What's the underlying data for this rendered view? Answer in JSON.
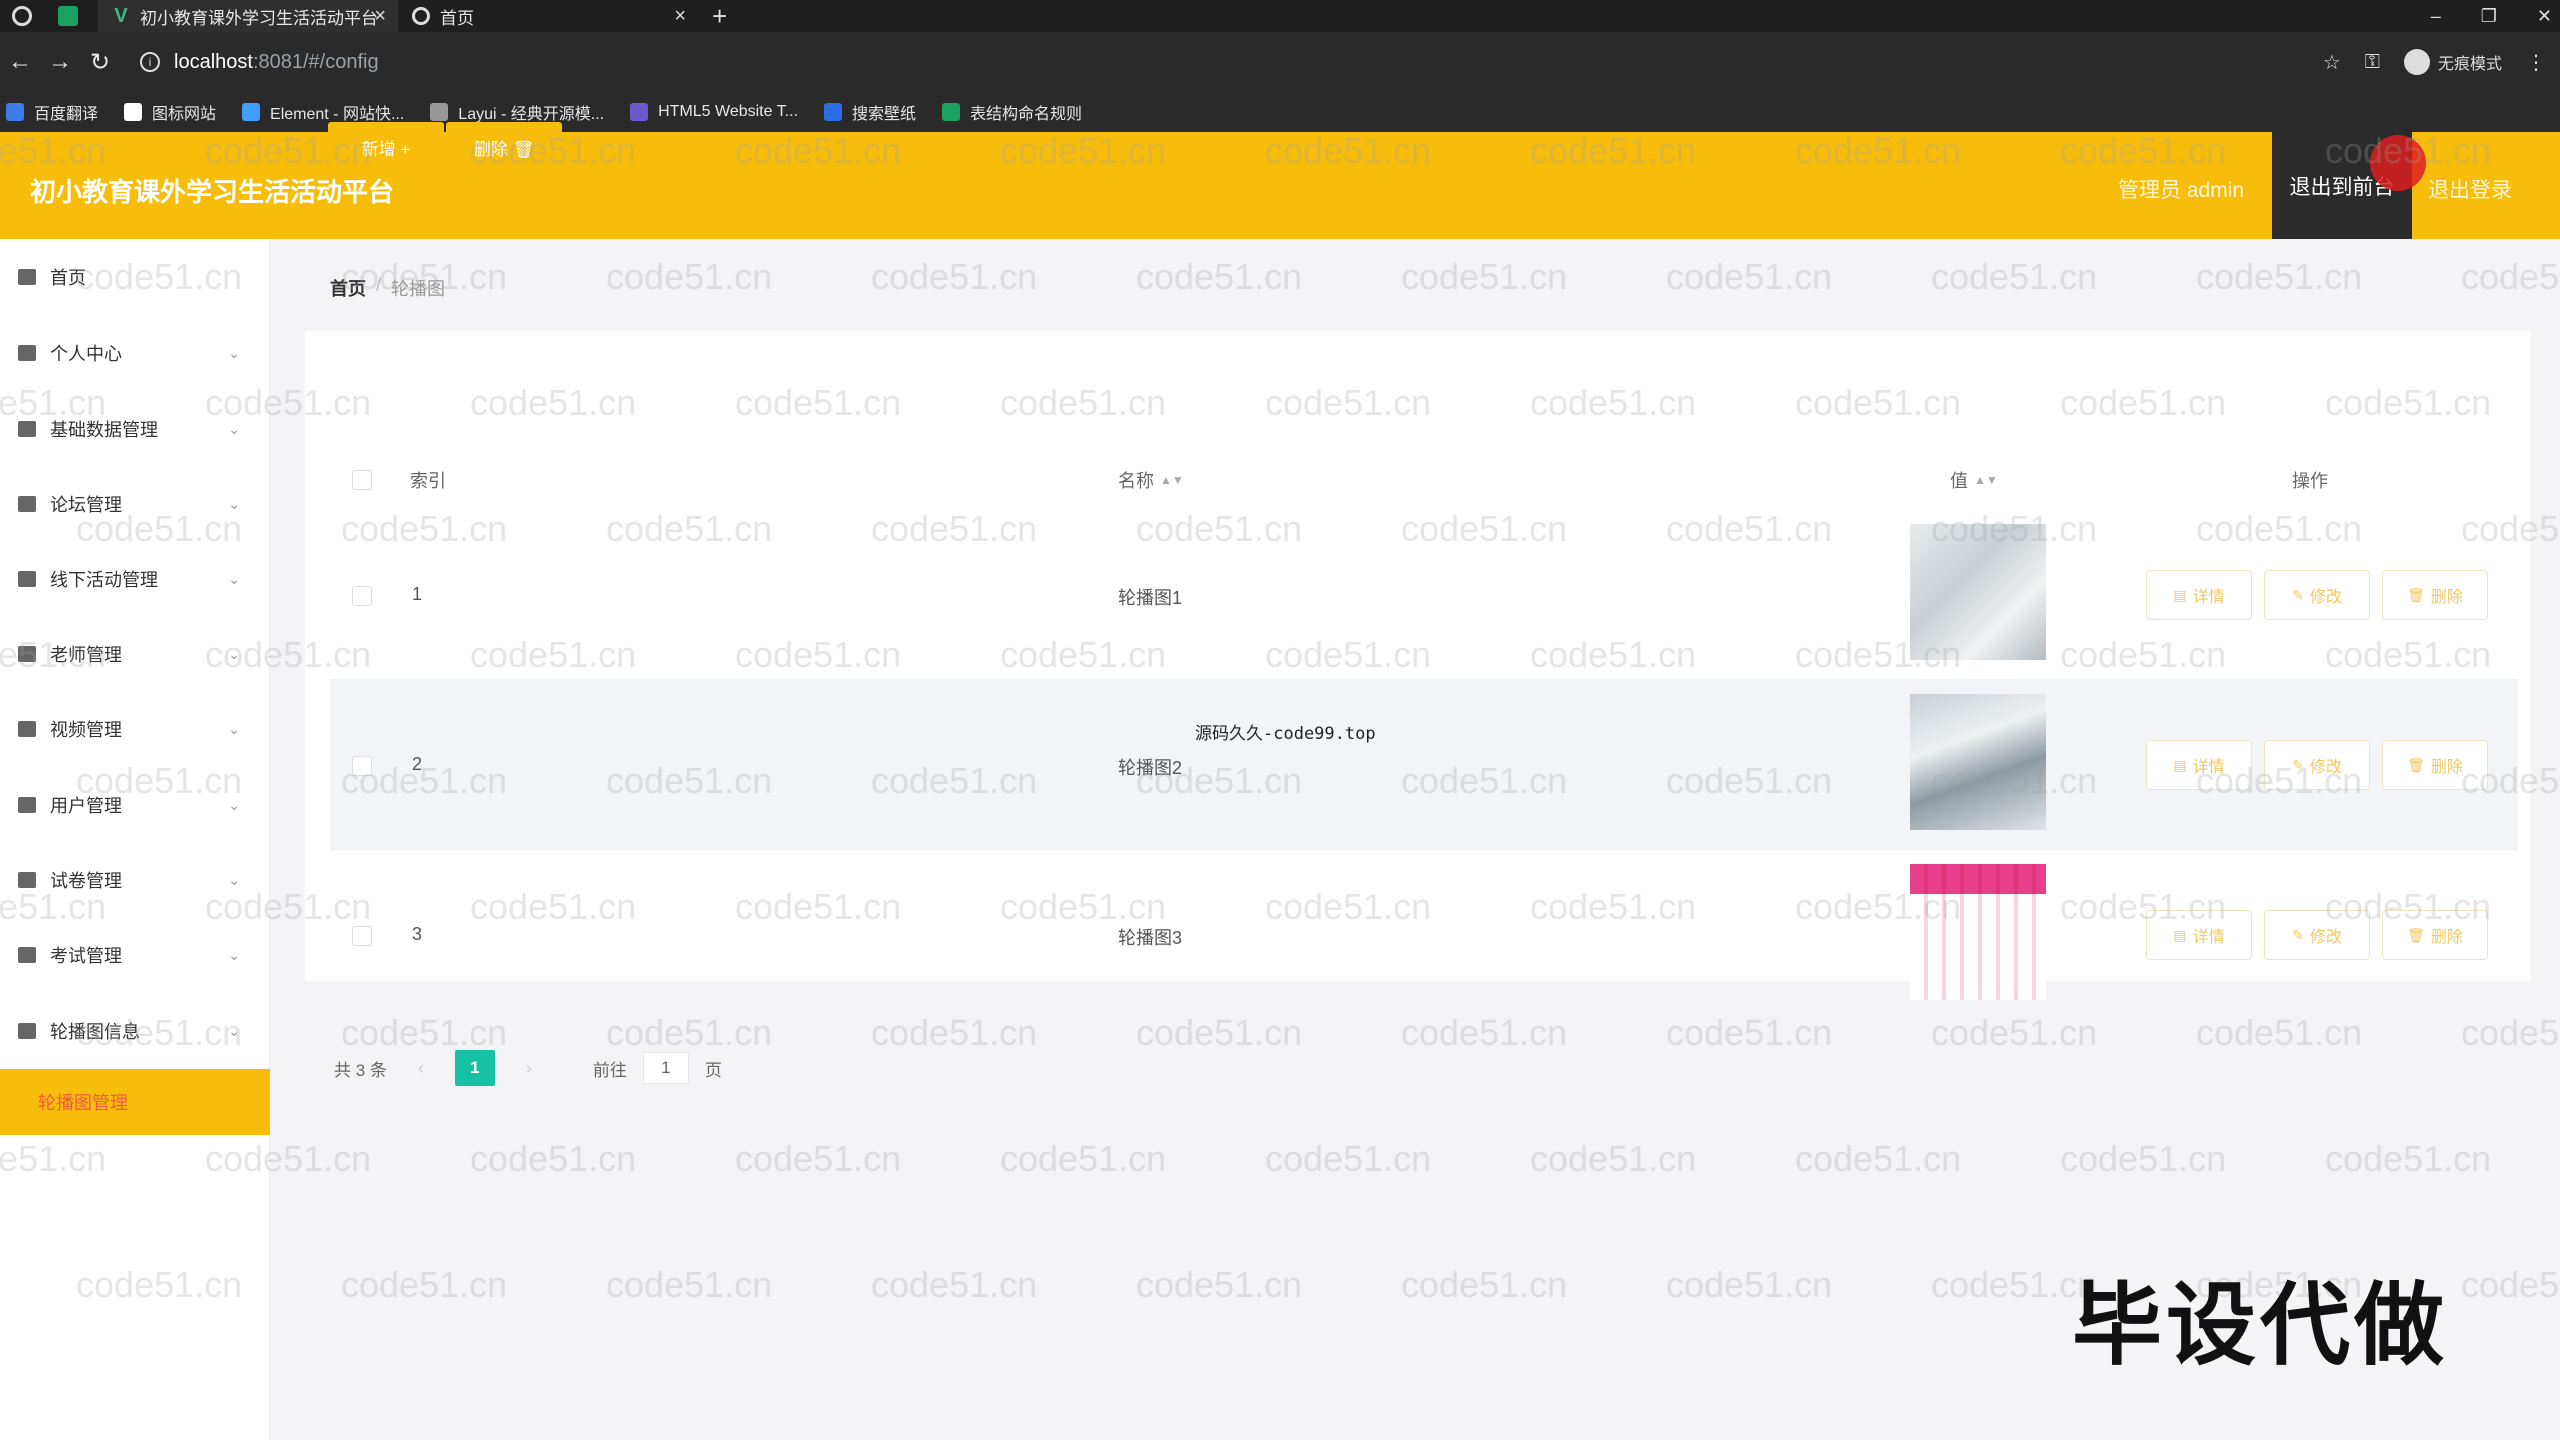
{
  "browser": {
    "tabs": [
      {
        "title": "初小教育课外学习生活活动平台",
        "close": "×"
      },
      {
        "title": "首页",
        "close": "×"
      }
    ],
    "new_tab": "+",
    "url_host": "localhost",
    "url_path": ":8081/#/config",
    "incognito_label": "无痕模式",
    "bookmarks": [
      {
        "label": "百度翻译",
        "color": "#3b7ce8"
      },
      {
        "label": "图标网站",
        "color": "#ffffff"
      },
      {
        "label": "Element - 网站快...",
        "color": "#409eff"
      },
      {
        "label": "Layui - 经典开源模...",
        "color": "#999999"
      },
      {
        "label": "HTML5 Website T...",
        "color": "#6a5acd"
      },
      {
        "label": "搜索壁纸",
        "color": "#2b6de0"
      },
      {
        "label": "表结构命名规则",
        "color": "#1aa260"
      }
    ]
  },
  "header": {
    "title": "初小教育课外学习生活活动平台",
    "admin_label": "管理员 admin",
    "back_front": "退出到前台",
    "logout": "退出登录",
    "bg_color": "#f7bd0c"
  },
  "sidebar": {
    "items": [
      {
        "label": "首页",
        "icon": "home-icon"
      },
      {
        "label": "个人中心",
        "icon": "user-icon"
      },
      {
        "label": "基础数据管理",
        "icon": "data-icon"
      },
      {
        "label": "论坛管理",
        "icon": "forum-icon"
      },
      {
        "label": "线下活动管理",
        "icon": "activity-icon"
      },
      {
        "label": "老师管理",
        "icon": "teacher-icon"
      },
      {
        "label": "视频管理",
        "icon": "video-icon"
      },
      {
        "label": "用户管理",
        "icon": "flag-icon"
      },
      {
        "label": "试卷管理",
        "icon": "paper-icon"
      },
      {
        "label": "考试管理",
        "icon": "exam-icon"
      },
      {
        "label": "轮播图信息",
        "icon": "carousel-icon"
      }
    ],
    "active_sub": "轮播图管理"
  },
  "breadcrumb": {
    "home": "首页",
    "sep": "/",
    "current": "轮播图"
  },
  "toolbar": {
    "add_label": "新增 +",
    "delete_label": "删除 🗑"
  },
  "table": {
    "headers": {
      "index": "索引",
      "name": "名称",
      "value": "值",
      "ops": "操作"
    },
    "rows": [
      {
        "index": "1",
        "name": "轮播图1"
      },
      {
        "index": "2",
        "name": "轮播图2"
      },
      {
        "index": "3",
        "name": "轮播图3"
      }
    ],
    "op_detail": "详情",
    "op_edit": "修改",
    "op_delete": "删除"
  },
  "tooltip": "源码久久-code99.top",
  "pagination": {
    "total": "共 3 条",
    "page": "1",
    "goto": "前往",
    "goto_value": "1",
    "page_unit": "页"
  },
  "watermark": "code51.cn",
  "stamp": "毕设代做"
}
